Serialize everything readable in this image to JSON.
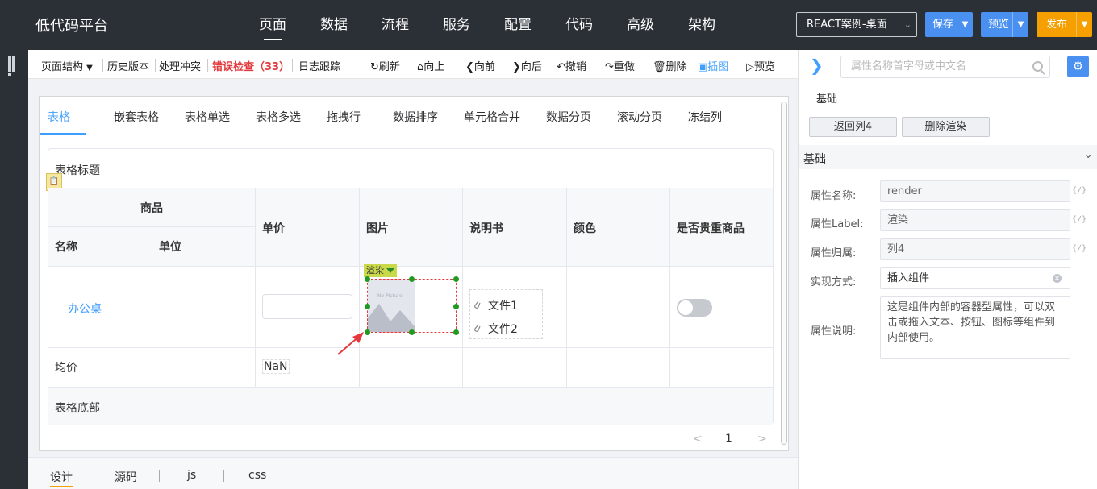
{
  "app": {
    "brand": "低代码平台"
  },
  "nav": [
    {
      "label": "页面",
      "active": true
    },
    {
      "label": "数据"
    },
    {
      "label": "流程"
    },
    {
      "label": "服务"
    },
    {
      "label": "配置"
    },
    {
      "label": "代码"
    },
    {
      "label": "高级"
    },
    {
      "label": "架构"
    }
  ],
  "topbar": {
    "env_select": "REACT案例-桌面",
    "save_label": "保存",
    "preview_label": "预览",
    "publish_label": "发布"
  },
  "toolbar": {
    "page_structure": "页面结构",
    "history": "历史版本",
    "conflict": "处理冲突",
    "error_check": "错误检查（33）",
    "log": "日志跟踪",
    "refresh": "刷新",
    "up": "向上",
    "forward": "向前",
    "backward": "向后",
    "undo": "撤销",
    "redo": "重做",
    "delete": "删除",
    "insert_image": "插图",
    "preview": "预览"
  },
  "tabs": [
    "表格",
    "嵌套表格",
    "表格单选",
    "表格多选",
    "拖拽行",
    "数据排序",
    "单元格合并",
    "数据分页",
    "滚动分页",
    "冻结列"
  ],
  "table": {
    "title": "表格标题",
    "footer": "表格底部",
    "group_header": "商品",
    "headers": {
      "name": "名称",
      "unit": "单位",
      "price": "单价",
      "image": "图片",
      "manual": "说明书",
      "color": "颜色",
      "valuable": "是否贵重商品"
    },
    "row": {
      "name": "办公桌",
      "render_tag": "渲染",
      "placeholder_text": "No Picture",
      "files": [
        "文件1",
        "文件2"
      ]
    },
    "avg_row": {
      "label": "均价",
      "price": "NaN"
    }
  },
  "pager": {
    "prev": "<",
    "page": "1",
    "next": ">"
  },
  "bottom_tabs": [
    "设计",
    "源码",
    "js",
    "css"
  ],
  "right_panel": {
    "search_placeholder": "属性名称首字母或中文名",
    "section_tab": "基础",
    "back_button": "返回列4",
    "delete_render_button": "删除渲染",
    "group_title": "基础",
    "expr_mark": "{/}",
    "props": [
      {
        "label": "属性名称:",
        "value": "render"
      },
      {
        "label": "属性Label:",
        "value": "渲染"
      },
      {
        "label": "属性归属:",
        "value": "列4"
      },
      {
        "label": "实现方式:",
        "value": "插入组件"
      }
    ],
    "desc_label": "属性说明:",
    "desc_text": "这是组件内部的容器型属性，可以双击或拖入文本、按钮、图标等组件到内部使用。"
  },
  "colors": {
    "topbar": "#2b2f36",
    "accent": "#409eff",
    "error": "#e4393c",
    "publish": "#f5a000"
  }
}
